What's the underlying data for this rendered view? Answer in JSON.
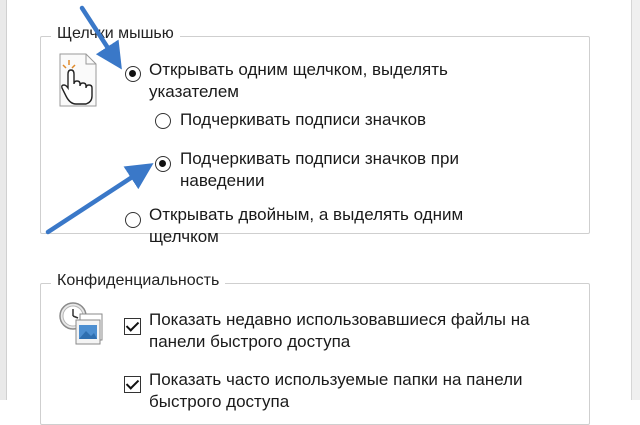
{
  "click_group": {
    "title": "Щелчки мышью",
    "options": [
      {
        "label": "Открывать одним щелчком, выделять указателем",
        "selected": true
      },
      {
        "label": "Подчеркивать подписи значков",
        "selected": false
      },
      {
        "label": "Подчеркивать подписи значков при наведении",
        "selected": true
      },
      {
        "label": "Открывать двойным, а выделять одним щелчком",
        "selected": false
      }
    ]
  },
  "privacy_group": {
    "title": "Конфиденциальность",
    "options": [
      {
        "label": "Показать недавно использовавшиеся файлы на панели быстрого доступа",
        "checked": true
      },
      {
        "label": "Показать часто используемые папки на панели быстрого доступа",
        "checked": true
      }
    ]
  },
  "annotation_color": "#3a78c8"
}
